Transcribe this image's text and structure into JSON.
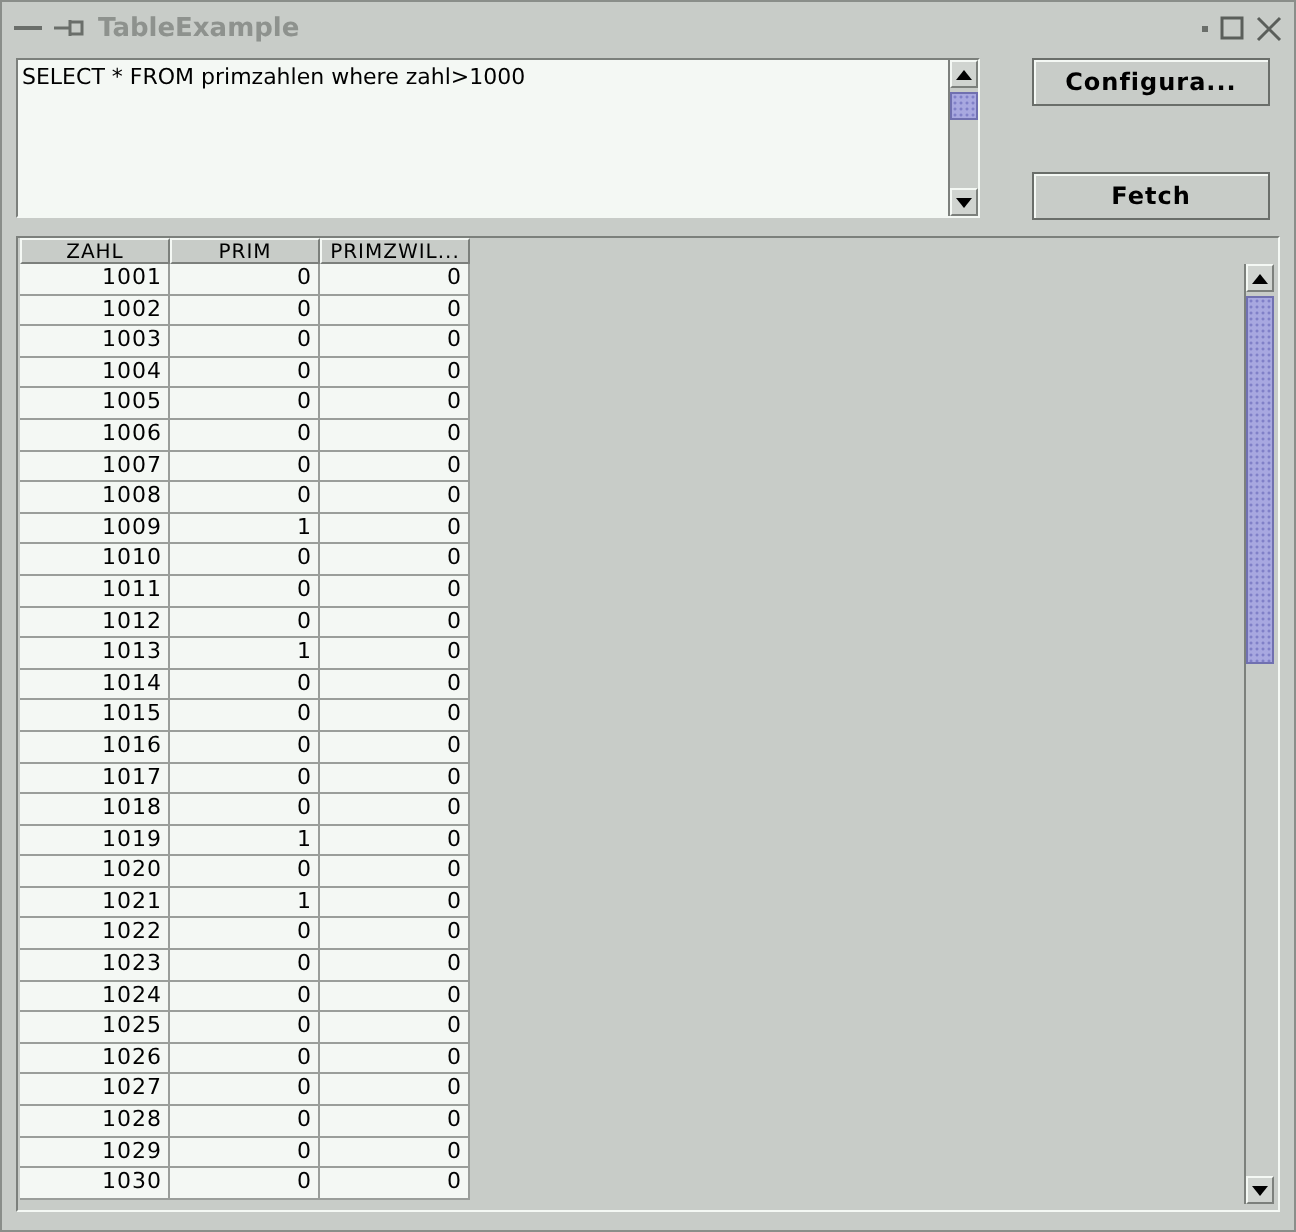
{
  "window": {
    "title": "TableExample"
  },
  "query": {
    "value": "SELECT * FROM primzahlen where zahl>1000"
  },
  "buttons": [
    {
      "label": "Configura..."
    },
    {
      "label": "Fetch"
    }
  ],
  "table": {
    "columns": [
      "ZAHL",
      "PRIM",
      "PRIMZWIL..."
    ],
    "rows": [
      [
        "1001",
        "0",
        "0"
      ],
      [
        "1002",
        "0",
        "0"
      ],
      [
        "1003",
        "0",
        "0"
      ],
      [
        "1004",
        "0",
        "0"
      ],
      [
        "1005",
        "0",
        "0"
      ],
      [
        "1006",
        "0",
        "0"
      ],
      [
        "1007",
        "0",
        "0"
      ],
      [
        "1008",
        "0",
        "0"
      ],
      [
        "1009",
        "1",
        "0"
      ],
      [
        "1010",
        "0",
        "0"
      ],
      [
        "1011",
        "0",
        "0"
      ],
      [
        "1012",
        "0",
        "0"
      ],
      [
        "1013",
        "1",
        "0"
      ],
      [
        "1014",
        "0",
        "0"
      ],
      [
        "1015",
        "0",
        "0"
      ],
      [
        "1016",
        "0",
        "0"
      ],
      [
        "1017",
        "0",
        "0"
      ],
      [
        "1018",
        "0",
        "0"
      ],
      [
        "1019",
        "1",
        "0"
      ],
      [
        "1020",
        "0",
        "0"
      ],
      [
        "1021",
        "1",
        "0"
      ],
      [
        "1022",
        "0",
        "0"
      ],
      [
        "1023",
        "0",
        "0"
      ],
      [
        "1024",
        "0",
        "0"
      ],
      [
        "1025",
        "0",
        "0"
      ],
      [
        "1026",
        "0",
        "0"
      ],
      [
        "1027",
        "0",
        "0"
      ],
      [
        "1028",
        "0",
        "0"
      ],
      [
        "1029",
        "0",
        "0"
      ],
      [
        "1030",
        "0",
        "0"
      ]
    ]
  }
}
